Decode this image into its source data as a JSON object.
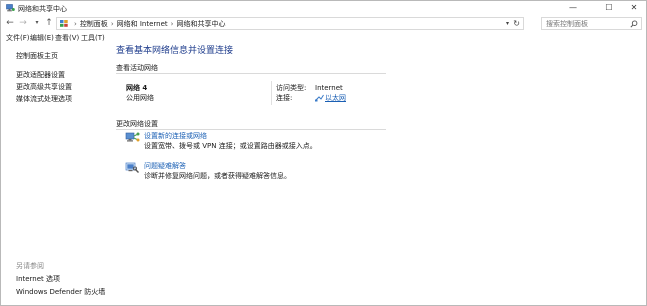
{
  "window": {
    "title": "网络和共享中心",
    "controls": {
      "minimize": "—",
      "maximize": "☐",
      "close": "✕"
    }
  },
  "address_bar": {
    "breadcrumbs": [
      "控制面板",
      "网络和 Internet",
      "网络和共享中心"
    ],
    "search_placeholder": "搜索控制面板"
  },
  "menu": [
    "文件(F)",
    "编辑(E)",
    "查看(V)",
    "工具(T)"
  ],
  "sidebar": {
    "home": "控制面板主页",
    "links": [
      "更改适配器设置",
      "更改高级共享设置",
      "媒体流式处理选项"
    ],
    "see_also_heading": "另请参阅",
    "see_also": [
      "Internet 选项",
      "Windows Defender 防火墙"
    ]
  },
  "main": {
    "title": "查看基本网络信息并设置连接",
    "active_heading": "查看活动网络",
    "network_name": "网络 4",
    "network_type": "公用网络",
    "access_type_label": "访问类型:",
    "access_type_value": "Internet",
    "connections_label": "连接:",
    "connection_name": "以太网",
    "change_heading": "更改网络设置",
    "tasks": [
      {
        "icon": "network-setup-icon",
        "link": "设置新的连接或网络",
        "description": "设置宽带、拨号或 VPN 连接；或设置路由器或接入点。"
      },
      {
        "icon": "troubleshoot-icon",
        "link": "问题疑难解答",
        "description": "诊断并修复网络问题，或者获得疑难解答信息。"
      }
    ]
  },
  "colors": {
    "title_blue": "#1e3c8c",
    "link_blue": "#1a5fb4",
    "divider": "#dadada"
  }
}
